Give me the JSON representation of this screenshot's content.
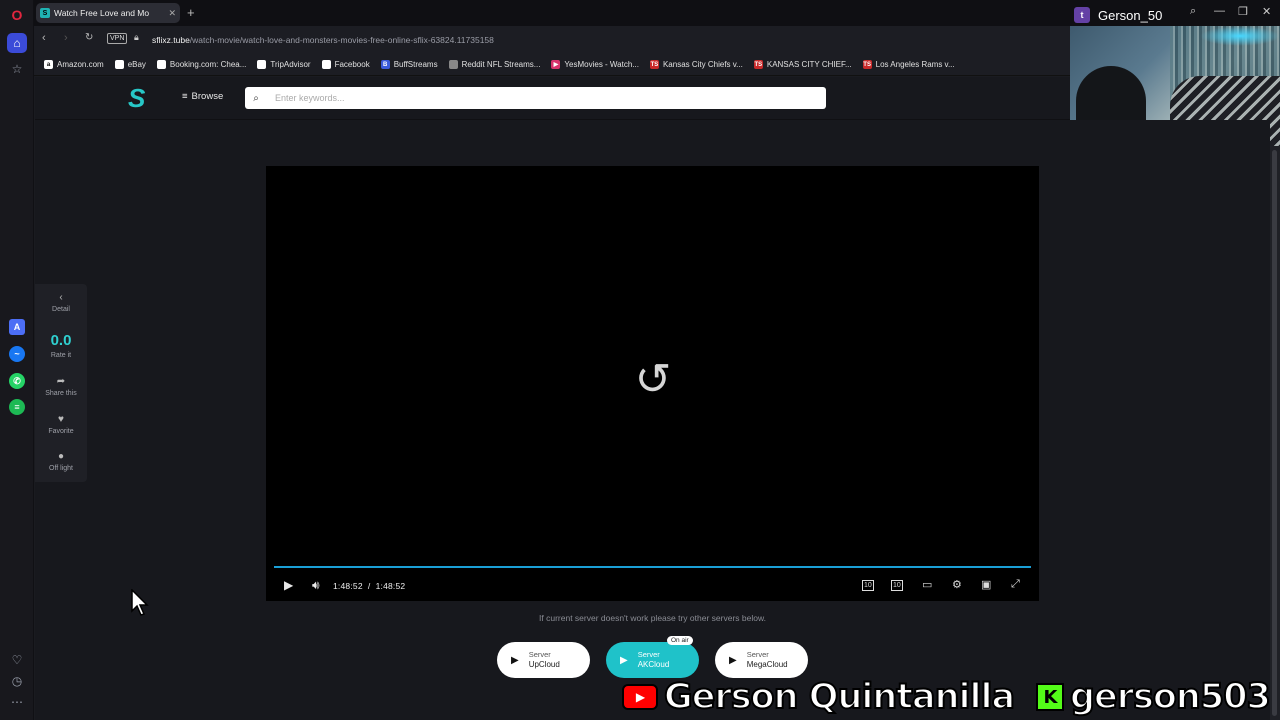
{
  "browser": {
    "tab_title": "Watch Free Love and Mo",
    "tab_favicon": "S",
    "new_tab": "+",
    "twitch_user": "Gerson_50",
    "url_domain": "sflixz.tube",
    "url_path": "/watch-movie/watch-love-and-monsters-movies-free-online-sflix-63824.11735158",
    "vpn_label": "VPN",
    "bookmarks": [
      {
        "label": "Amazon.com",
        "icon": "a",
        "color": "#ffffff"
      },
      {
        "label": "eBay",
        "icon": "",
        "color": "#ffffff"
      },
      {
        "label": "Booking.com: Chea...",
        "icon": "",
        "color": "#ffffff"
      },
      {
        "label": "TripAdvisor",
        "icon": "",
        "color": "#ffffff"
      },
      {
        "label": "Facebook",
        "icon": "",
        "color": "#ffffff"
      },
      {
        "label": "BuffStreams",
        "icon": "B",
        "color": "#3b5bdb"
      },
      {
        "label": "Reddit NFL Streams...",
        "icon": "",
        "color": "#888888"
      },
      {
        "label": "YesMovies - Watch...",
        "icon": "▶",
        "color": "#d6336c"
      },
      {
        "label": "Kansas City Chiefs v...",
        "icon": "TS",
        "color": "#c92a2a"
      },
      {
        "label": "KANSAS CITY CHIEF...",
        "icon": "TS",
        "color": "#c92a2a"
      },
      {
        "label": "Los Angeles Rams v...",
        "icon": "TS",
        "color": "#c92a2a"
      }
    ]
  },
  "site": {
    "logo": "S",
    "browse_label": "Browse",
    "search_placeholder": "Enter keywords..."
  },
  "sidepanel": {
    "detail_label": "Detail",
    "rating_value": "0.0",
    "rate_label": "Rate it",
    "share_label": "Share this",
    "favorite_label": "Favorite",
    "offlight_label": "Off light"
  },
  "player": {
    "current_time": "1:48:52",
    "separator": "/",
    "duration": "1:48:52",
    "progress": 1.0,
    "rewind_label": "10",
    "forward_label": "10"
  },
  "servers": {
    "note": "If current server doesn't work please try other servers below.",
    "on_air": "On air",
    "list": [
      {
        "prefix": "Server",
        "name": "UpCloud",
        "active": false
      },
      {
        "prefix": "Server",
        "name": "AKCloud",
        "active": true
      },
      {
        "prefix": "Server",
        "name": "MegaCloud",
        "active": false
      }
    ]
  },
  "overlay": {
    "youtube_name": "Gerson Quintanilla",
    "kick_name": "gerson503"
  },
  "colors": {
    "accent": "#1fc2c9",
    "progress": "#1a9fd6",
    "opera_red": "#e2263f"
  }
}
